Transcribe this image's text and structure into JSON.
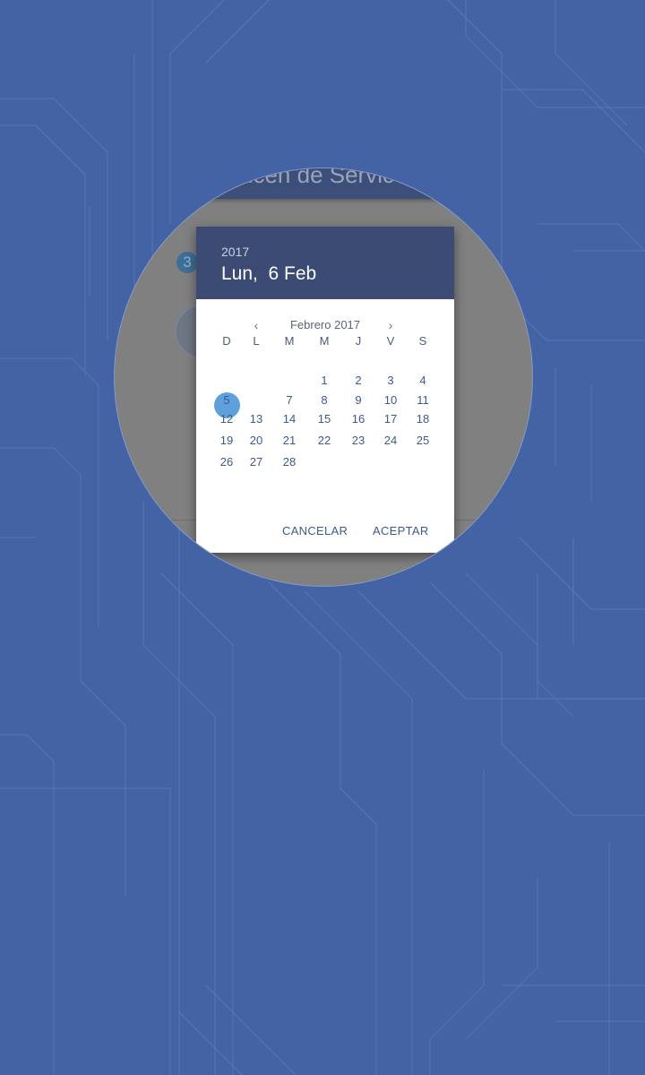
{
  "app": {
    "title_partial": "ncen de Servic",
    "badge": "3"
  },
  "picker": {
    "header_year": "2017",
    "header_date": "Lun,  6 Feb",
    "prev_icon": "‹",
    "next_icon": "›",
    "month_label": "Febrero 2017",
    "weekdays": [
      "D",
      "L",
      "M",
      "M",
      "J",
      "V",
      "S"
    ],
    "first_weekday_index": 3,
    "days": [
      "1",
      "2",
      "3",
      "4",
      "5",
      "6",
      "7",
      "8",
      "9",
      "10",
      "11",
      "12",
      "13",
      "14",
      "15",
      "16",
      "17",
      "18",
      "19",
      "20",
      "21",
      "22",
      "23",
      "24",
      "25",
      "26",
      "27",
      "28"
    ],
    "selected_day": "6",
    "cancel_label": "CANCELAR",
    "accept_label": "ACEPTAR"
  },
  "colors": {
    "background": "#4463a5",
    "header": "#3b4b73",
    "selected": "#5ea0dc",
    "text_accent": "#3e5a8c"
  }
}
